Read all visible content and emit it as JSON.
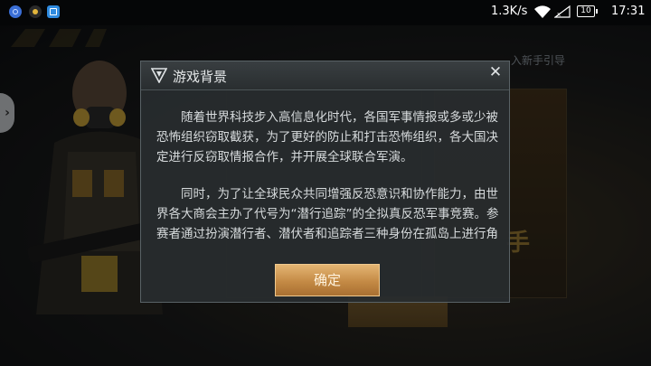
{
  "status_bar": {
    "net_speed": "1.3K/s",
    "battery": "10",
    "time": "17:31",
    "icons": [
      "app-icon-blue",
      "app-icon-yellow",
      "app-icon-file",
      "wifi-icon",
      "signal-icon",
      "battery-icon"
    ]
  },
  "dialog": {
    "title": "游戏背景",
    "close_glyph": "✕",
    "paragraphs": [
      "随着世界科技步入高信息化时代，各国军事情报或多或少被恐怖组织窃取截获，为了更好的防止和打击恐怖组织，各大国决定进行反窃取情报合作，并开展全球联合军演。",
      "同时，为了让全球民众共同增强反恐意识和协作能力，由世界各大商会主办了代号为“潜行追踪”的全拟真反恐军事竞赛。参赛者通过扮演潜行者、潜伏者和追踪者三种身份在孤岛上进行角"
    ],
    "confirm_label": "确定"
  },
  "background": {
    "tab_last": "入新手引导",
    "side_arrow": "›"
  },
  "colors": {
    "accent": "#c48a45",
    "dialog_bg": "#2c3032"
  }
}
